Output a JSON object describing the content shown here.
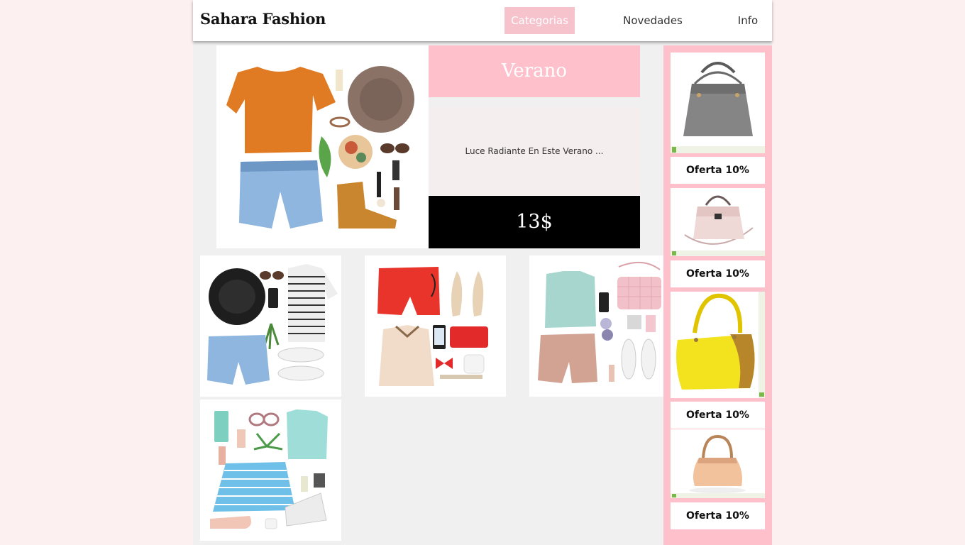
{
  "header": {
    "brand": "Sahara Fashion",
    "nav": [
      "Categorias",
      "Novedades",
      "Info"
    ]
  },
  "featured": {
    "title": "Verano",
    "description": "Luce Radiante En Este Verano ...",
    "price": "13$"
  },
  "sidebar": {
    "offers": [
      "Oferta 10%",
      "Oferta 10%",
      "Oferta 10%",
      "Oferta 10%"
    ]
  },
  "colors": {
    "accent_pink": "#fec0cb",
    "page_background": "#fdf0f0",
    "price_background": "#000000"
  }
}
